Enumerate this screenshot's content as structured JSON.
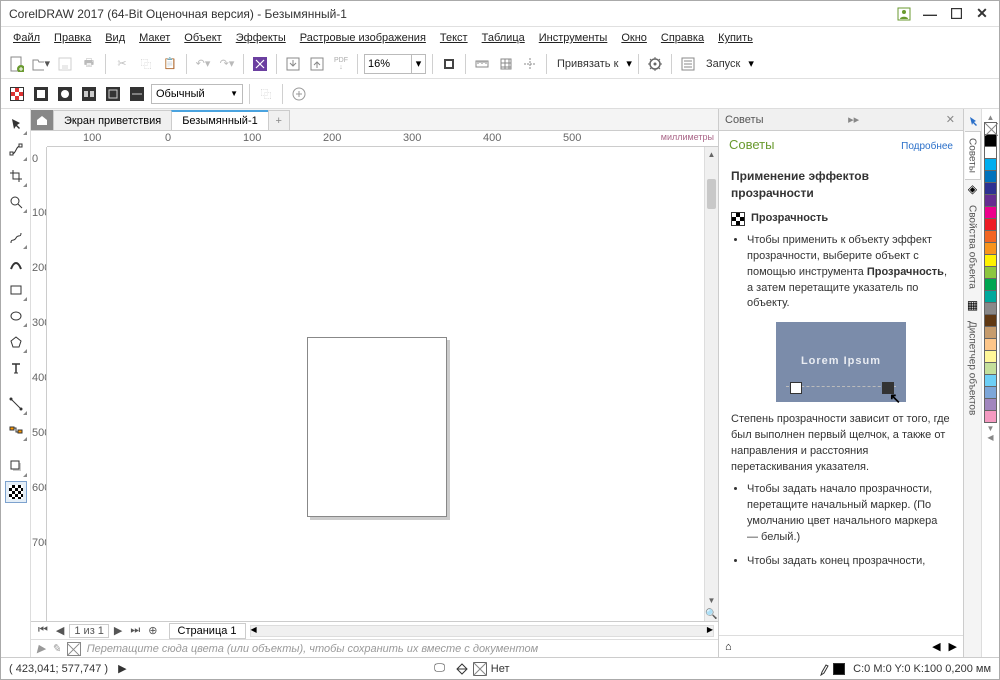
{
  "title": "CorelDRAW 2017 (64-Bit Оценочная версия) - Безымянный-1",
  "menu": [
    "Файл",
    "Правка",
    "Вид",
    "Макет",
    "Объект",
    "Эффекты",
    "Растровые изображения",
    "Текст",
    "Таблица",
    "Инструменты",
    "Окно",
    "Справка",
    "Купить"
  ],
  "zoom": "16%",
  "snap_label": "Привязать к",
  "launch_label": "Запуск",
  "propbar": {
    "style": "Обычный"
  },
  "tabs": {
    "welcome": "Экран приветствия",
    "doc": "Безымянный-1"
  },
  "ruler": {
    "unit": "миллиметры",
    "hvals": [
      "100",
      "0",
      "100",
      "200",
      "300",
      "400",
      "500"
    ],
    "vvals": [
      "0",
      "100",
      "200",
      "300",
      "400",
      "500",
      "600",
      "700"
    ]
  },
  "pagebar": {
    "range": "1 из 1",
    "page": "Страница 1"
  },
  "colorhint": "Перетащите сюда цвета (или объекты), чтобы сохранить их вместе с документом",
  "hints": {
    "docker_title": "Советы",
    "panel_title": "Советы",
    "more": "Подробнее",
    "heading": "Применение эффектов прозрачности",
    "sub": "Прозрачность",
    "p1a": "Чтобы применить к объекту эффект прозрачности, выберите объект с помощью инструмента ",
    "p1b": "Прозрачность",
    "p1c": ", а затем перетащите указатель по объекту.",
    "demo_text": "Lorem Ipsum",
    "p2": "Степень прозрачности зависит от того, где был выполнен первый щелчок, а также от направления и расстояния перетаскивания указателя.",
    "li2": "Чтобы задать начало прозрачности, перетащите начальный маркер. (По умолчанию цвет начального маркера — белый.)",
    "li3": "Чтобы задать конец прозрачности,"
  },
  "sidetabs": [
    "Советы",
    "Свойства объекта",
    "Диспетчер объектов"
  ],
  "palette": [
    "#000",
    "#fff",
    "#00aeef",
    "#ec008c",
    "#fff200",
    "#ed1c24",
    "#00a651",
    "#2e3192",
    "#f7941d",
    "#898989",
    "#603913",
    "#92278f",
    "#c4df9b",
    "#6dcff6"
  ],
  "status": {
    "coords": "( 423,041; 577,747 )",
    "fill_label": "Нет",
    "outline": "C:0 M:0 Y:0 K:100 0,200 мм"
  }
}
